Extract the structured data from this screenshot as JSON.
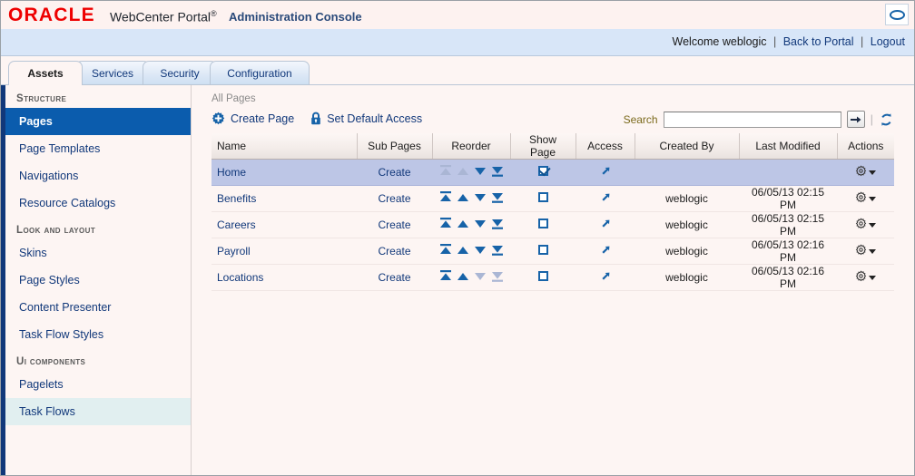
{
  "header": {
    "logo": "ORACLE",
    "product": "WebCenter Portal",
    "registered_mark": "®",
    "console": "Administration Console",
    "brand_icon": "oracle-oval-icon"
  },
  "welcome": {
    "greeting": "Welcome weblogic",
    "sep1": "|",
    "back_to_portal": "Back to Portal",
    "sep2": "|",
    "logout": "Logout"
  },
  "tabs": [
    {
      "label": "Assets",
      "active": true
    },
    {
      "label": "Services",
      "active": false
    },
    {
      "label": "Security",
      "active": false
    },
    {
      "label": "Configuration",
      "active": false
    }
  ],
  "sidebar": {
    "groups": [
      {
        "title": "STRUCTURE",
        "items": [
          {
            "label": "Pages",
            "state": "selected"
          },
          {
            "label": "Page Templates",
            "state": "normal"
          },
          {
            "label": "Navigations",
            "state": "normal"
          },
          {
            "label": "Resource Catalogs",
            "state": "normal"
          }
        ]
      },
      {
        "title": "LOOK AND LAYOUT",
        "items": [
          {
            "label": "Skins",
            "state": "normal"
          },
          {
            "label": "Page Styles",
            "state": "normal"
          },
          {
            "label": "Content Presenter",
            "state": "normal"
          },
          {
            "label": "Task Flow Styles",
            "state": "normal"
          }
        ]
      },
      {
        "title": "UI COMPONENTS",
        "items": [
          {
            "label": "Pagelets",
            "state": "normal"
          },
          {
            "label": "Task Flows",
            "state": "hover"
          }
        ]
      }
    ],
    "collapse_glyph": "❮"
  },
  "main": {
    "breadcrumb": "All Pages",
    "toolbar": {
      "create_page": "Create Page",
      "set_default_access": "Set Default Access"
    },
    "search": {
      "label": "Search",
      "value": "",
      "placeholder": "",
      "go_glyph": "→"
    },
    "columns": [
      "Name",
      "Sub Pages",
      "Reorder",
      "Show Page",
      "Access",
      "Created By",
      "Last Modified",
      "Actions"
    ],
    "rows": [
      {
        "name": "Home",
        "sub_pages": "Create",
        "reorder": {
          "top": "disabled",
          "up": "disabled",
          "down": "enabled",
          "bottom": "enabled"
        },
        "show_page": true,
        "access": "access-arrow-icon",
        "created_by": "",
        "last_modified": "",
        "selected": true
      },
      {
        "name": "Benefits",
        "sub_pages": "Create",
        "reorder": {
          "top": "enabled",
          "up": "enabled",
          "down": "enabled",
          "bottom": "enabled"
        },
        "show_page": false,
        "access": "access-arrow-icon",
        "created_by": "weblogic",
        "last_modified": "06/05/13 02:15 PM",
        "selected": false
      },
      {
        "name": "Careers",
        "sub_pages": "Create",
        "reorder": {
          "top": "enabled",
          "up": "enabled",
          "down": "enabled",
          "bottom": "enabled"
        },
        "show_page": false,
        "access": "access-arrow-icon",
        "created_by": "weblogic",
        "last_modified": "06/05/13 02:15 PM",
        "selected": false
      },
      {
        "name": "Payroll",
        "sub_pages": "Create",
        "reorder": {
          "top": "enabled",
          "up": "enabled",
          "down": "enabled",
          "bottom": "enabled"
        },
        "show_page": false,
        "access": "access-arrow-icon",
        "created_by": "weblogic",
        "last_modified": "06/05/13 02:16 PM",
        "selected": false
      },
      {
        "name": "Locations",
        "sub_pages": "Create",
        "reorder": {
          "top": "enabled",
          "up": "enabled",
          "down": "disabled",
          "bottom": "disabled"
        },
        "show_page": false,
        "access": "access-arrow-icon",
        "created_by": "weblogic",
        "last_modified": "06/05/13 02:16 PM",
        "selected": false
      }
    ]
  },
  "colors": {
    "brand_red": "#ee0000",
    "link_blue": "#11387a",
    "selected_nav": "#0b5cad",
    "row_selected": "#bdc6e6",
    "icon_blue": "#1763a8",
    "search_label": "#7b6a1c",
    "page_bg": "#fdf5f3"
  }
}
